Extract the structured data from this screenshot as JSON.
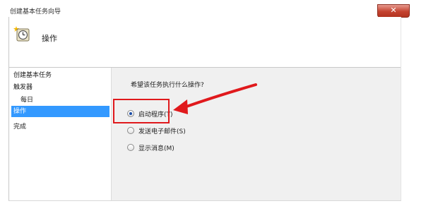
{
  "window": {
    "title": "创建基本任务向导",
    "close_glyph": "✕"
  },
  "header": {
    "icon": "task-clock-icon",
    "title": "操作"
  },
  "sidebar": {
    "items": [
      {
        "label": "创建基本任务",
        "active": false
      },
      {
        "label": "触发器",
        "active": false
      },
      {
        "label": "每日",
        "active": false
      },
      {
        "label": "操作",
        "active": true
      },
      {
        "label": "完成",
        "active": false
      }
    ]
  },
  "content": {
    "question": "希望该任务执行什么操作?",
    "options": [
      {
        "label": "启动程序(T)",
        "checked": true
      },
      {
        "label": "发送电子邮件(S)",
        "checked": false
      },
      {
        "label": "显示消息(M)",
        "checked": false
      }
    ]
  },
  "annotation": {
    "highlight_color": "#e0191c"
  }
}
